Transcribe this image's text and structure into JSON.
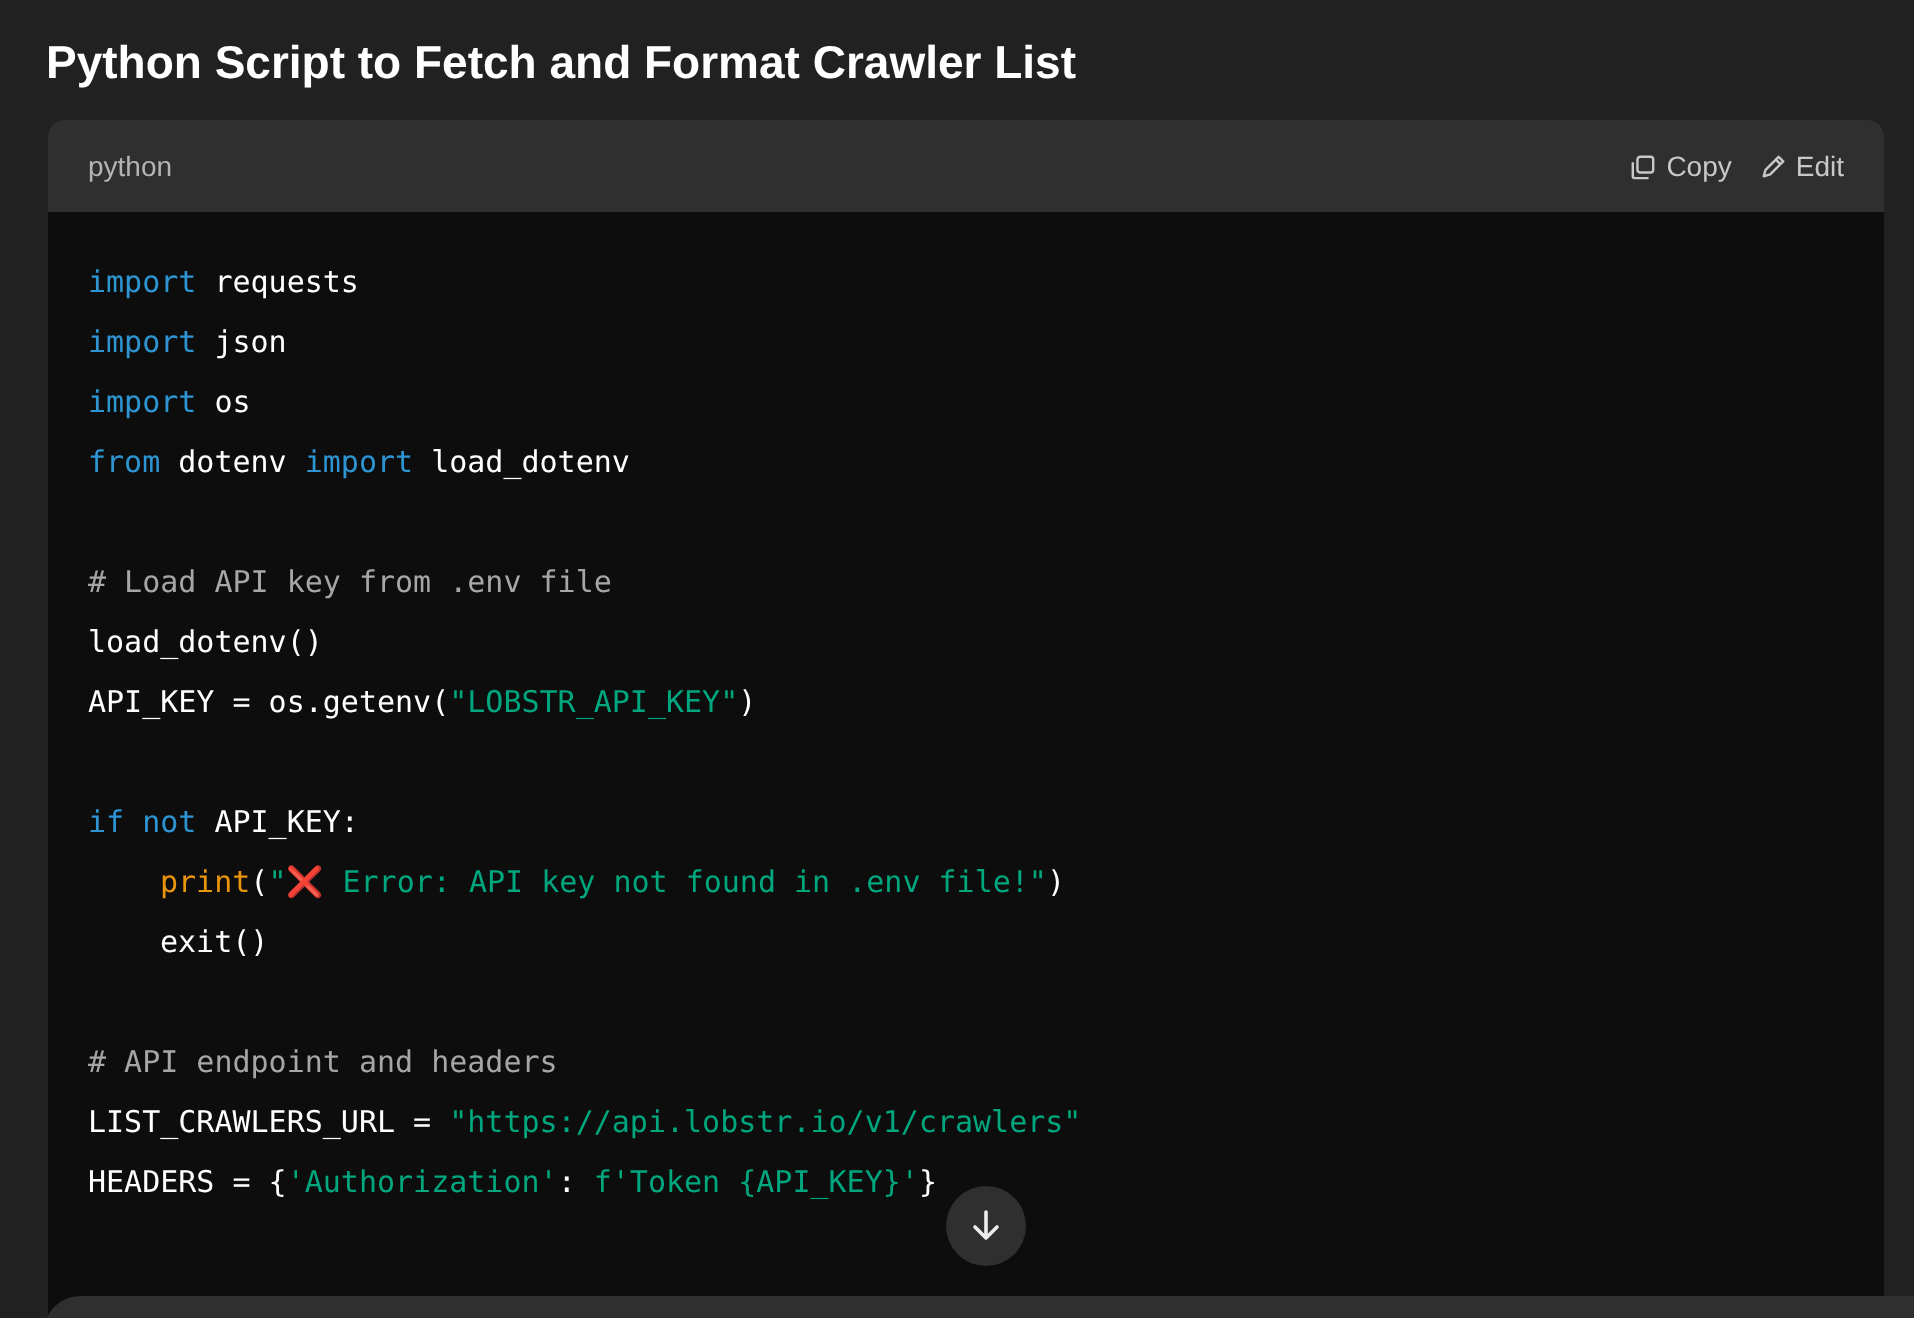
{
  "title": "Python Script to Fetch and Format Crawler List",
  "code_block": {
    "language": "python",
    "actions": [
      {
        "kind": "copy",
        "label": "Copy"
      },
      {
        "kind": "edit",
        "label": "Edit"
      }
    ],
    "lines": [
      [
        {
          "kind": "kw",
          "text": "import"
        },
        {
          "kind": "plain",
          "text": " requests"
        }
      ],
      [
        {
          "kind": "kw",
          "text": "import"
        },
        {
          "kind": "plain",
          "text": " json"
        }
      ],
      [
        {
          "kind": "kw",
          "text": "import"
        },
        {
          "kind": "plain",
          "text": " os"
        }
      ],
      [
        {
          "kind": "kw",
          "text": "from"
        },
        {
          "kind": "plain",
          "text": " dotenv "
        },
        {
          "kind": "kw",
          "text": "import"
        },
        {
          "kind": "plain",
          "text": " load_dotenv"
        }
      ],
      [
        {
          "kind": "comment",
          "text": "# Load API key from .env file"
        }
      ],
      [
        {
          "kind": "plain",
          "text": "load_dotenv()"
        }
      ],
      [
        {
          "kind": "plain",
          "text": "API_KEY = os.getenv("
        },
        {
          "kind": "str",
          "text": "\"LOBSTR_API_KEY\""
        },
        {
          "kind": "plain",
          "text": ")"
        }
      ],
      [
        {
          "kind": "kw",
          "text": "if not"
        },
        {
          "kind": "plain",
          "text": " API_KEY:"
        }
      ],
      [
        {
          "kind": "fn",
          "text": "print"
        },
        {
          "kind": "plain",
          "text": "("
        },
        {
          "kind": "str",
          "text": "\""
        },
        {
          "kind": "emoji",
          "text": "❌"
        },
        {
          "kind": "str",
          "text": " Error: API key not found in .env file!\""
        },
        {
          "kind": "plain",
          "text": ")"
        }
      ],
      [
        {
          "kind": "plain",
          "text": "exit()"
        }
      ],
      [
        {
          "kind": "comment",
          "text": "# API endpoint and headers"
        }
      ],
      [
        {
          "kind": "plain",
          "text": "LIST_CRAWLERS_URL = "
        },
        {
          "kind": "str",
          "text": "\"https://api.lobstr.io/v1/crawlers\""
        }
      ],
      [
        {
          "kind": "plain",
          "text": "HEADERS = {"
        },
        {
          "kind": "str",
          "text": "'Authorization'"
        },
        {
          "kind": "plain",
          "text": ": "
        },
        {
          "kind": "str",
          "text": "f'Token {API_KEY}'"
        },
        {
          "kind": "plain",
          "text": "}"
        }
      ]
    ],
    "layout": [
      {
        "gap_before": false,
        "indented": false
      },
      {
        "gap_before": false,
        "indented": false
      },
      {
        "gap_before": false,
        "indented": false
      },
      {
        "gap_before": false,
        "indented": false
      },
      {
        "gap_before": true,
        "indented": false
      },
      {
        "gap_before": false,
        "indented": false
      },
      {
        "gap_before": false,
        "indented": false
      },
      {
        "gap_before": true,
        "indented": false
      },
      {
        "gap_before": false,
        "indented": true
      },
      {
        "gap_before": false,
        "indented": true
      },
      {
        "gap_before": true,
        "indented": false
      },
      {
        "gap_before": false,
        "indented": false
      },
      {
        "gap_before": false,
        "indented": false
      }
    ]
  }
}
